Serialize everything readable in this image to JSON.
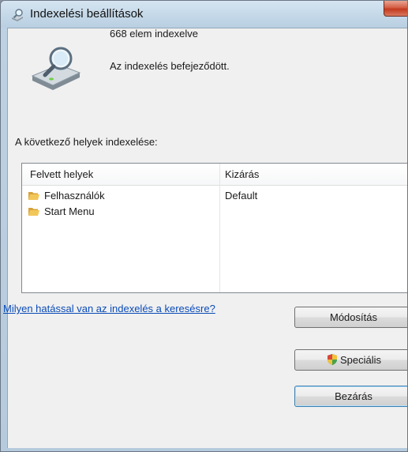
{
  "window": {
    "title": "Indexelési beállítások"
  },
  "status": {
    "count_text": "668 elem indexelve",
    "state_text": "Az indexelés befejeződött."
  },
  "locations": {
    "section_label": "A következő helyek indexelése:",
    "columns": [
      "Felvett helyek",
      "Kizárás"
    ],
    "rows": [
      {
        "name": "Felhasználók",
        "exclude": "Default"
      },
      {
        "name": "Start Menu",
        "exclude": ""
      }
    ]
  },
  "help_link": "Milyen hatással van az indexelés a keresésre?",
  "buttons": {
    "modify": "Módosítás",
    "advanced": "Speciális",
    "close": "Bezárás"
  },
  "icons": {
    "title": "magnifier-drive-icon",
    "status": "indexing-drive-icon",
    "folder": "folder-icon",
    "shield": "uac-shield-icon"
  },
  "colors": {
    "link": "#0a4bb8",
    "close_button": "#c23a1f",
    "folder": "#e8b84a"
  }
}
